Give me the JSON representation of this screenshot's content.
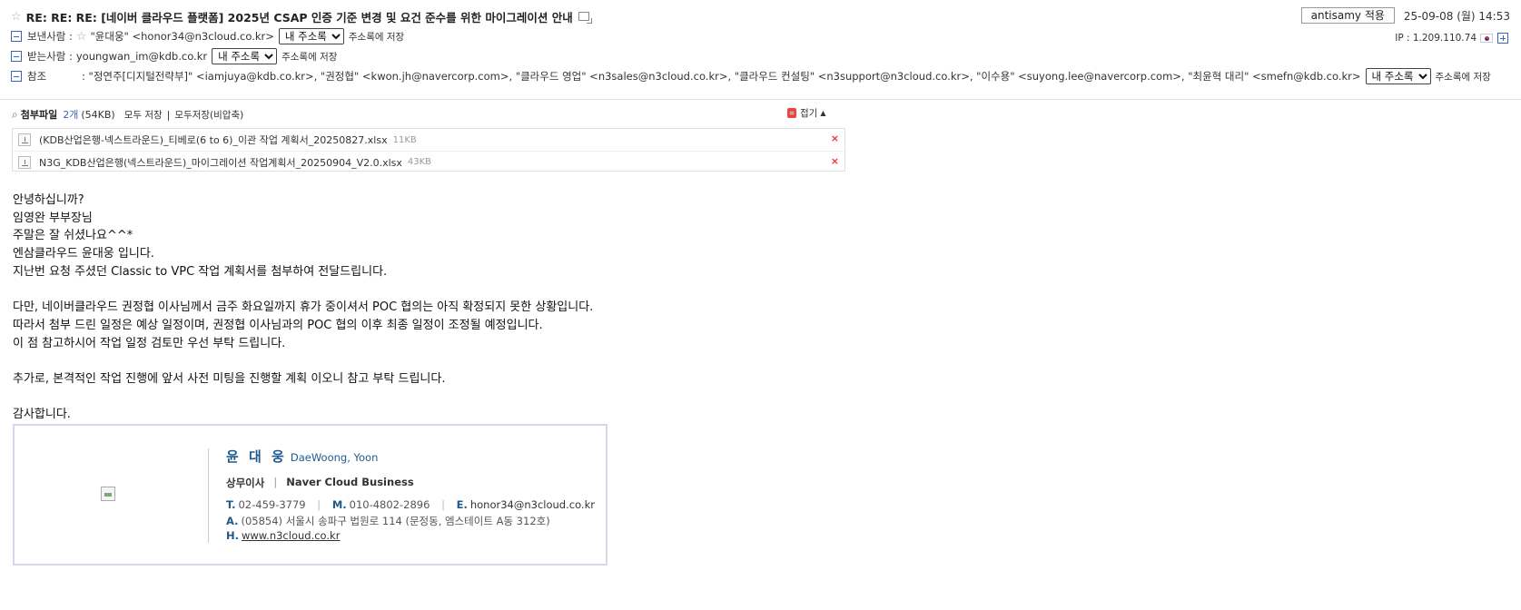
{
  "header": {
    "subject": "RE: RE: RE: [네이버 클라우드 플랫폼] 2025년 CSAP 인증 기준 변경 및 요건 준수를 위한 마이그레이션 안내",
    "antisamy_button": "antisamy 적용",
    "datetime": "25-09-08 (월) 14:53",
    "ip": "IP : 1.209.110.74"
  },
  "from": {
    "label": "보낸사람 :",
    "value": "\"윤대웅\" <honor34@n3cloud.co.kr>",
    "select": "내 주소록",
    "save": "주소록에 저장"
  },
  "to": {
    "label": "받는사람 :",
    "value": "youngwan_im@kdb.co.kr",
    "select": "내 주소록",
    "save": "주소록에 저장"
  },
  "cc": {
    "label": "참조",
    "value": ": \"정연주[디지털전략부]\" <iamjuya@kdb.co.kr>, \"권정협\" <kwon.jh@navercorp.com>, \"클라우드 영업\" <n3sales@n3cloud.co.kr>, \"클라우드 컨설팅\" <n3support@n3cloud.co.kr>, \"이수용\" <suyong.lee@navercorp.com>, \"최윤혁 대리\" <smefn@kdb.co.kr>",
    "select": "내 주소록",
    "save": "주소록에 저장"
  },
  "attachments": {
    "title": "첨부파일",
    "count": "2개",
    "size": "(54KB)",
    "save_all": "모두 저장",
    "save_all_uncompressed": "모두저장(비압축)",
    "fold": "접기",
    "files": [
      {
        "name": "(KDB산업은행-넥스트라운드)_티베로(6 to 6)_이관 작업 계획서_20250827.xlsx",
        "size": "11KB"
      },
      {
        "name": "N3G_KDB산업은행(넥스트라운드)_마이그레이션 작업계획서_20250904_V2.0.xlsx",
        "size": "43KB"
      }
    ]
  },
  "body": {
    "lines": [
      "안녕하십니까?",
      "임영완 부부장님",
      "주말은 잘 쉬셨나요^^*",
      "엔삼클라우드 윤대웅 입니다.",
      "지난번 요청 주셨던 Classic to VPC 작업 계획서를 첨부하여 전달드립니다.",
      "",
      "다만, 네이버클라우드 권정협 이사님께서 금주 화요일까지 휴가 중이셔서 POC 협의는 아직 확정되지 못한 상황입니다.",
      "따라서 첨부 드린 일정은 예상 일정이며, 권정협 이사님과의 POC 협의 이후 최종 일정이 조정될 예정입니다.",
      "이 점 참고하시어 작업 일정 검토만 우선 부탁 드립니다.",
      "",
      "추가로, 본격적인 작업 진행에 앞서 사전 미팅을 진행할 계획 이오니 참고 부탁 드립니다.",
      "",
      "감사합니다."
    ]
  },
  "signature": {
    "name_ko": "윤 대 웅",
    "name_en": "DaeWoong, Yoon",
    "title": "상무이사",
    "company": "Naver Cloud  Business",
    "tel_key": "T.",
    "tel": "02-459-3779",
    "mobile_key": "M.",
    "mobile": "010-4802-2896",
    "email_key": "E.",
    "email": "honor34@n3cloud.co.kr",
    "address_key": "A.",
    "address": "(05854) 서울시 송파구 법원로 114 (문정동, 엠스테이트 A동 312호)",
    "home_key": "H.",
    "homepage": "www.n3cloud.co.kr"
  }
}
